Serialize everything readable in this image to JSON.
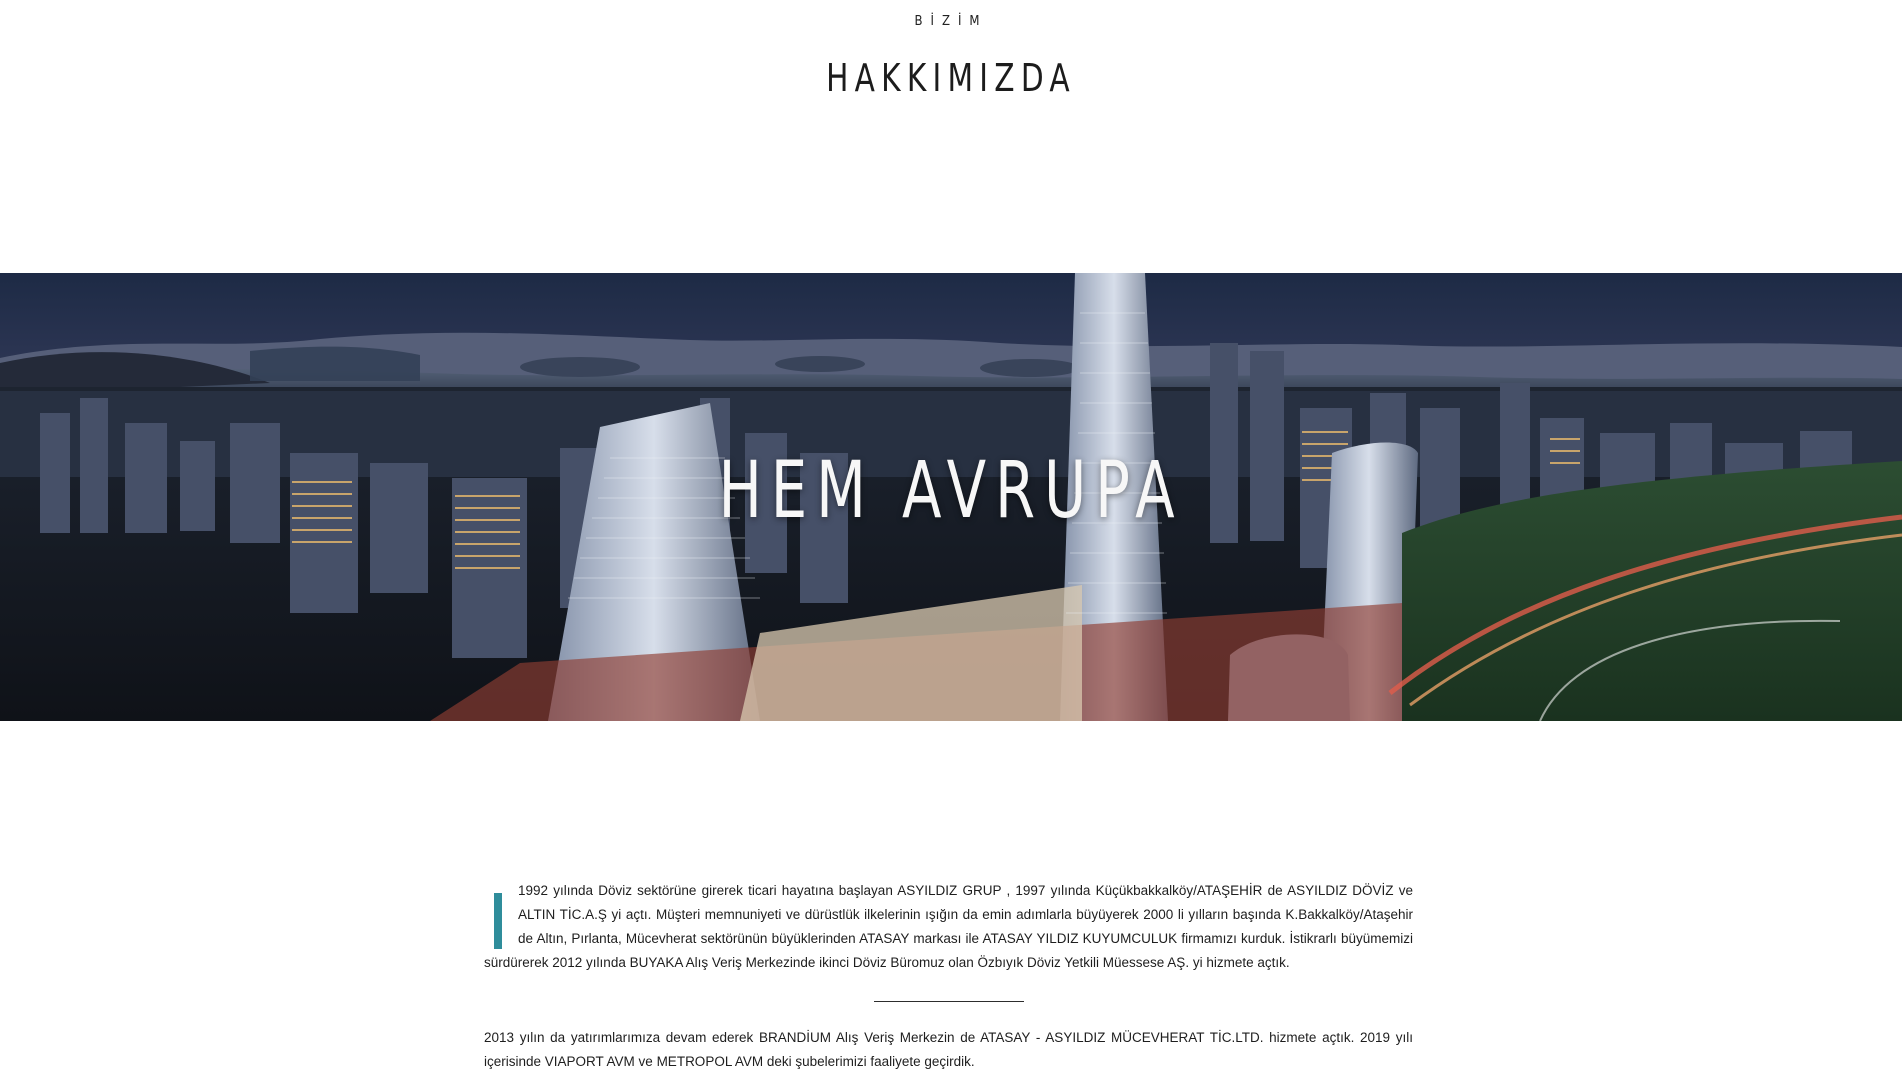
{
  "header": {
    "eyebrow": "BİZİM",
    "title": "HAKKIMIZDA"
  },
  "hero": {
    "title": "HEM AVRUPA",
    "image_description": "night city skyline with towers"
  },
  "article": {
    "paragraph1": "1992 yılında Döviz sektörüne girerek ticari hayatına başlayan ASYILDIZ GRUP , 1997 yılında Küçükbakkalköy/ATAŞEHİR de ASYILDIZ DÖVİZ ve ALTIN TİC.A.Ş yi açtı. Müşteri memnuniyeti ve dürüstlük ilkelerinin ışığın da emin adımlarla büyüyerek 2000 li yılların başında K.Bakkalköy/Ataşehir de Altın, Pırlanta, Mücevherat sektörünün büyüklerinden ATASAY markası ile ATASAY YILDIZ KUYUMCULUK firmamızı kurduk. İstikrarlı büyümemizi sürdürerek 2012 yılında BUYAKA Alış Veriş Merkezinde ikinci Döviz Büromuz olan Özbıyık Döviz Yetkili Müessese AŞ. yi hizmete açtık.",
    "paragraph2": "2013 yılın da yatırımlarımıza devam ederek BRANDİUM Alış Veriş Merkezin de ATASAY - ASYILDIZ MÜCEVHERAT TİC.LTD. hizmete açtık. 2019 yılı içerisinde VIAPORT AVM ve METROPOL AVM deki şubelerimizi faaliyete geçirdik."
  },
  "colors": {
    "accent": "#2f8d9b",
    "text": "#1e1e1e"
  }
}
